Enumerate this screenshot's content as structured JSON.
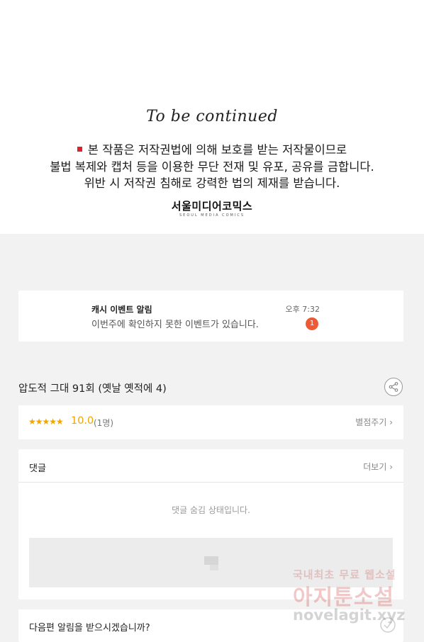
{
  "hero": {
    "to_be_continued": "To be continued",
    "notice_lines": [
      "본 작품은 저작권법에 의해 보호를 받는 저작물이므로",
      "불법 복제와 캡처 등을 이용한 무단 전재 및 유포, 공유를 금합니다.",
      "위반 시 저작권 침해로 강력한 법의 제재를 받습니다."
    ],
    "publisher_name": "서울미디어코믹스",
    "publisher_sub": "SEOUL MEDIA COMICS"
  },
  "event_notice": {
    "title": "캐시 이벤트 알림",
    "time": "오후 7:32",
    "message": "이번주에 확인하지 못한 이벤트가 있습니다.",
    "badge": "1"
  },
  "episode": {
    "title": "압도적 그대 91회 (옛날 옛적에 4)",
    "share_icon": "share-icon"
  },
  "rating": {
    "stars": "★★★★★",
    "score": "10.0",
    "count": "(1명)",
    "rate_link": "별점주기 ›"
  },
  "comments": {
    "title": "댓글",
    "more_link": "더보기 ›",
    "hidden_note": "댓글 숨김 상태입니다."
  },
  "notify": {
    "question": "다음편 알림을 받으시겠습니까?"
  },
  "watermark": {
    "line1": "국내최초 무료 웹소설",
    "line2": "아지툰소설",
    "line3": "novelagit.xyz"
  },
  "colors": {
    "accent_orange": "#f0a500",
    "badge_red": "#ef5a36",
    "notice_red": "#e0202a",
    "background": "#f2f2f2"
  }
}
